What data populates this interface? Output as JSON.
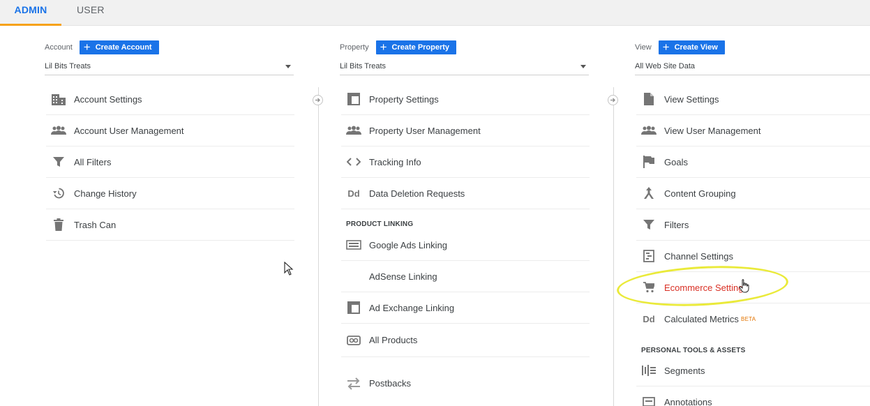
{
  "tabs": [
    {
      "label": "ADMIN",
      "active": true
    },
    {
      "label": "USER",
      "active": false
    }
  ],
  "account": {
    "label": "Account",
    "create_label": "Create Account",
    "selected": "Lil Bits Treats",
    "items": [
      {
        "label": "Account Settings",
        "icon": "building-icon"
      },
      {
        "label": "Account User Management",
        "icon": "people-icon"
      },
      {
        "label": "All Filters",
        "icon": "filter-icon"
      },
      {
        "label": "Change History",
        "icon": "history-icon"
      },
      {
        "label": "Trash Can",
        "icon": "trash-icon"
      }
    ]
  },
  "property": {
    "label": "Property",
    "create_label": "Create Property",
    "selected": "Lil Bits Treats",
    "items": [
      {
        "label": "Property Settings",
        "icon": "property-settings-icon"
      },
      {
        "label": "Property User Management",
        "icon": "people-icon"
      },
      {
        "label": "Tracking Info",
        "icon": "code-icon"
      },
      {
        "label": "Data Deletion Requests",
        "icon": "dd-icon"
      }
    ],
    "section_product_linking": "PRODUCT LINKING",
    "linking_items": [
      {
        "label": "Google Ads Linking",
        "icon": "ads-icon"
      },
      {
        "label": "AdSense Linking",
        "icon": ""
      },
      {
        "label": "Ad Exchange Linking",
        "icon": "ad-exchange-icon"
      },
      {
        "label": "All Products",
        "icon": "link-icon"
      },
      {
        "label": "Postbacks",
        "icon": "postbacks-icon"
      }
    ]
  },
  "view": {
    "label": "View",
    "create_label": "Create View",
    "selected": "All Web Site Data",
    "items": [
      {
        "label": "View Settings",
        "icon": "document-icon"
      },
      {
        "label": "View User Management",
        "icon": "people-icon"
      },
      {
        "label": "Goals",
        "icon": "flag-icon"
      },
      {
        "label": "Content Grouping",
        "icon": "content-grouping-icon"
      },
      {
        "label": "Filters",
        "icon": "filter-icon"
      },
      {
        "label": "Channel Settings",
        "icon": "channel-icon"
      },
      {
        "label": "Ecommerce Settings",
        "icon": "cart-icon",
        "active": true
      },
      {
        "label": "Calculated Metrics",
        "icon": "dd-icon",
        "badge": "BETA"
      }
    ],
    "section_personal": "PERSONAL TOOLS & ASSETS",
    "personal_items": [
      {
        "label": "Segments",
        "icon": "segments-icon"
      },
      {
        "label": "Annotations",
        "icon": "annotations-icon"
      }
    ]
  },
  "colors": {
    "accent": "#1a73e8",
    "tab_underline": "#f6a21a",
    "active_item": "#d93025",
    "highlight_ring": "#eaea3a",
    "beta": "#e37400"
  }
}
